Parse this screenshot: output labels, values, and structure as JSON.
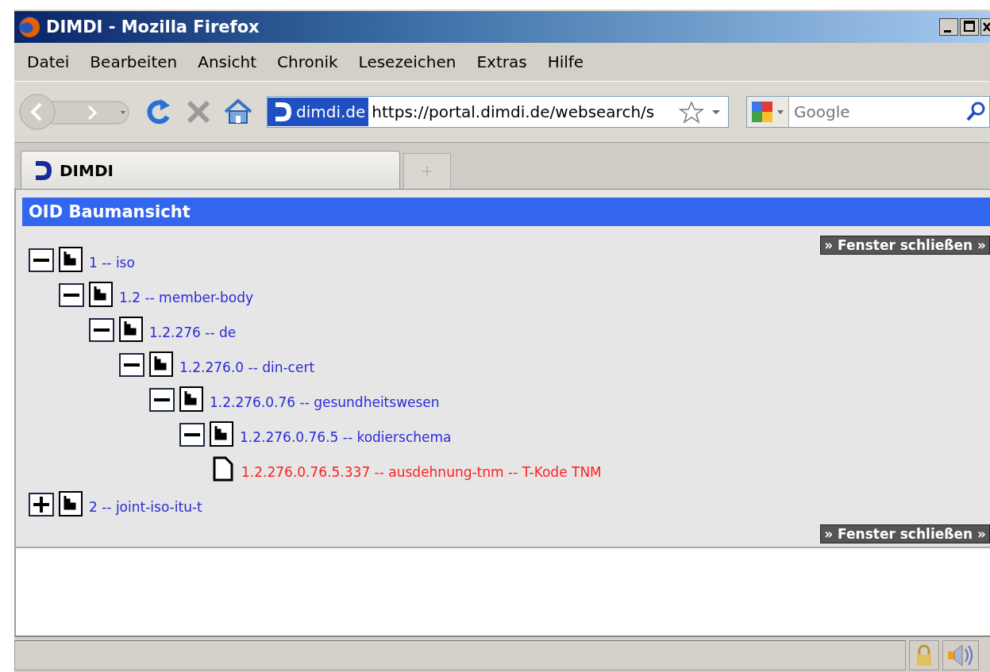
{
  "window": {
    "title": "DIMDI - Mozilla Firefox"
  },
  "menu": [
    {
      "label": "Datei"
    },
    {
      "label": "Bearbeiten"
    },
    {
      "label": "Ansicht"
    },
    {
      "label": "Chronik"
    },
    {
      "label": "Lesezeichen"
    },
    {
      "label": "Extras"
    },
    {
      "label": "Hilfe"
    }
  ],
  "toolbar": {
    "identity": "dimdi.de",
    "url": "https://portal.dimdi.de/websearch/s",
    "search": {
      "placeholder": "Google"
    }
  },
  "tabs": [
    {
      "label": "DIMDI",
      "selected": true
    }
  ],
  "page": {
    "heading": "OID Baumansicht",
    "close_buttons": [
      "» Fenster schließen »",
      "» Fenster schließen »"
    ],
    "tree": [
      {
        "kind": "branch",
        "label": "1 -- iso",
        "expanded": true,
        "selected": false,
        "children": [
          {
            "kind": "branch",
            "label": "1.2 -- member-body",
            "expanded": true,
            "selected": false,
            "children": [
              {
                "kind": "branch",
                "label": "1.2.276 -- de",
                "expanded": true,
                "selected": false,
                "children": [
                  {
                    "kind": "branch",
                    "label": "1.2.276.0 -- din-cert",
                    "expanded": true,
                    "selected": false,
                    "children": [
                      {
                        "kind": "branch",
                        "label": "1.2.276.0.76 -- gesundheitswesen",
                        "expanded": true,
                        "selected": false,
                        "children": [
                          {
                            "kind": "branch",
                            "label": "1.2.276.0.76.5 -- kodierschema",
                            "expanded": true,
                            "selected": false,
                            "children": [
                              {
                                "kind": "leaf",
                                "label": "1.2.276.0.76.5.337 -- ausdehnung-tnm -- T-Kode TNM",
                                "selected": true
                              }
                            ]
                          }
                        ]
                      }
                    ]
                  }
                ]
              }
            ]
          }
        ]
      },
      {
        "kind": "branch",
        "label": "2 -- joint-iso-itu-t",
        "expanded": false,
        "selected": false
      }
    ]
  }
}
